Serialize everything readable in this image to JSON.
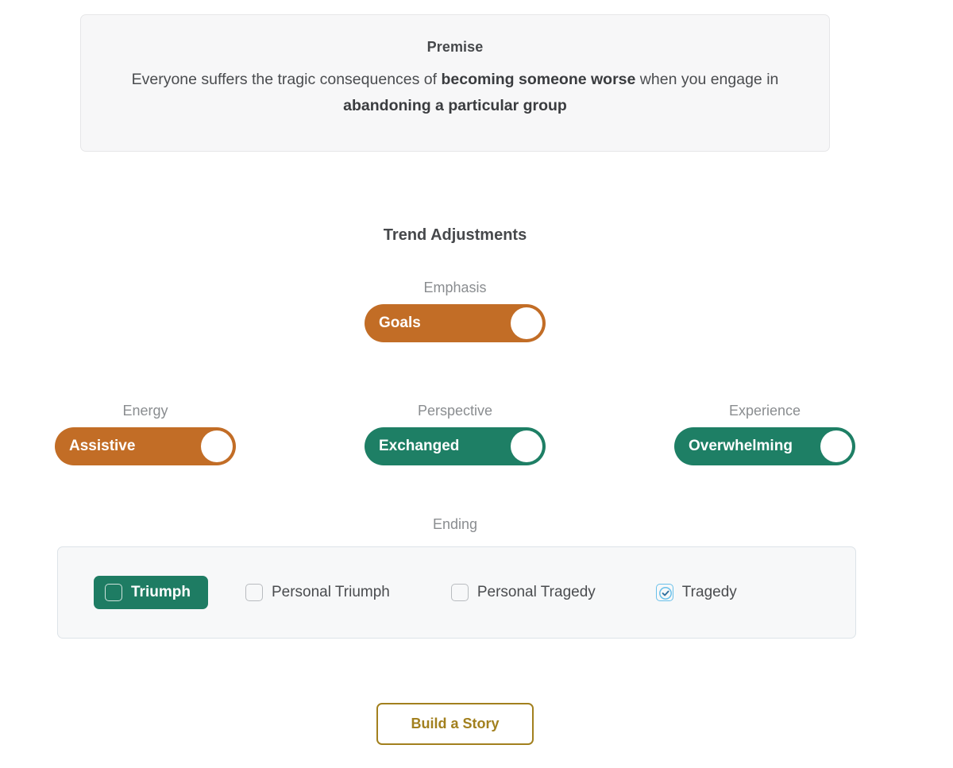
{
  "premise": {
    "title": "Premise",
    "text_parts": [
      {
        "text": "Everyone suffers the tragic consequences of ",
        "bold": false
      },
      {
        "text": "becoming someone worse",
        "bold": true
      },
      {
        "text": " when you engage in ",
        "bold": false
      },
      {
        "text": "abandoning a particular group",
        "bold": true
      }
    ],
    "full_text": "Everyone suffers the tragic consequences of becoming someone worse when you engage in abandoning a particular group"
  },
  "section": {
    "title": "Trend Adjustments"
  },
  "toggles": [
    {
      "id": "emphasis",
      "label": "Emphasis",
      "value": "Goals",
      "color": "#c26d26",
      "state": "on",
      "knob": "right"
    },
    {
      "id": "energy",
      "label": "Energy",
      "value": "Assistive",
      "color": "#c26d26",
      "state": "on",
      "knob": "right"
    },
    {
      "id": "perspective",
      "label": "Perspective",
      "value": "Exchanged",
      "color": "#1e7f65",
      "state": "on",
      "knob": "right"
    },
    {
      "id": "experience",
      "label": "Experience",
      "value": "Overwhelming",
      "color": "#1e7f65",
      "state": "on",
      "knob": "right"
    }
  ],
  "ending": {
    "label": "Ending",
    "options": [
      {
        "label": "Triumph",
        "checked": false,
        "highlighted": true
      },
      {
        "label": "Personal Triumph",
        "checked": false,
        "highlighted": false
      },
      {
        "label": "Personal Tragedy",
        "checked": false,
        "highlighted": false
      },
      {
        "label": "Tragedy",
        "checked": true,
        "highlighted": false
      }
    ]
  },
  "actions": {
    "build_label": "Build a Story"
  },
  "colors": {
    "orange": "#c26d26",
    "green": "#1e7f65",
    "gold": "#a2801e",
    "checked_blue": "#69c0ea",
    "card_bg": "#f7f7f8"
  }
}
